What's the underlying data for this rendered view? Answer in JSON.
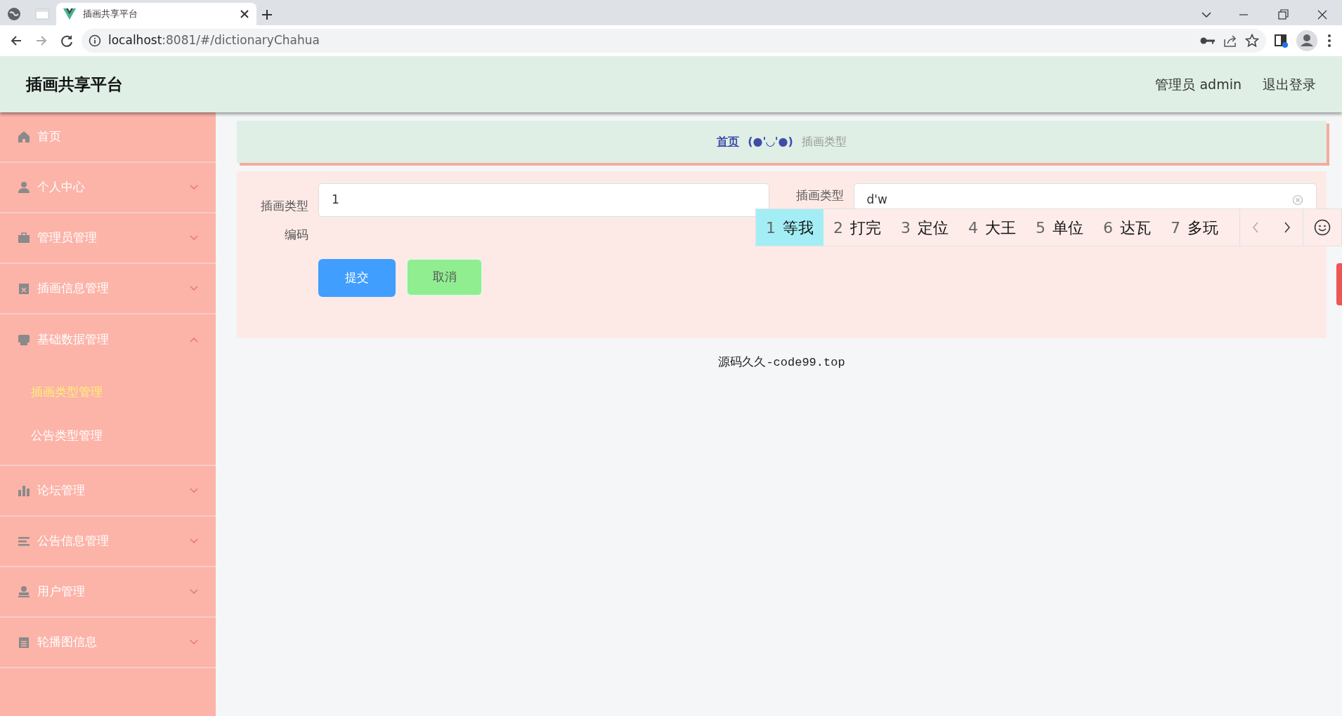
{
  "browser": {
    "tabs": [
      {
        "title": "插画共享平台",
        "selected": true
      }
    ],
    "url_host": "localhost",
    "url_rest": ":8081/#/dictionaryChahua"
  },
  "header": {
    "title": "插画共享平台",
    "user": "管理员 admin",
    "logout": "退出登录"
  },
  "sidebar": {
    "items": [
      {
        "label": "首页"
      },
      {
        "label": "个人中心",
        "expanded": false
      },
      {
        "label": "管理员管理",
        "expanded": false
      },
      {
        "label": "插画信息管理",
        "expanded": false
      },
      {
        "label": "基础数据管理",
        "expanded": true,
        "children": [
          {
            "label": "插画类型管理",
            "selected": true
          },
          {
            "label": "公告类型管理",
            "selected": false
          }
        ]
      },
      {
        "label": "论坛管理",
        "expanded": false
      },
      {
        "label": "公告信息管理",
        "expanded": false
      },
      {
        "label": "用户管理",
        "expanded": false
      },
      {
        "label": "轮播图信息",
        "expanded": false
      }
    ]
  },
  "breadcrumb": {
    "home": "首页",
    "separator": "(●'◡'●)",
    "current": "插画类型"
  },
  "form": {
    "fields": [
      {
        "label": "插画类型编码",
        "value": "1"
      },
      {
        "label": "插画类型",
        "value": "d'w"
      }
    ],
    "submit": "提交",
    "cancel": "取消"
  },
  "ime": {
    "candidates": [
      {
        "number": "1",
        "text": "等我",
        "selected": true
      },
      {
        "number": "2",
        "text": "打完",
        "selected": false
      },
      {
        "number": "3",
        "text": "定位",
        "selected": false
      },
      {
        "number": "4",
        "text": "大王",
        "selected": false
      },
      {
        "number": "5",
        "text": "单位",
        "selected": false
      },
      {
        "number": "6",
        "text": "达瓦",
        "selected": false
      },
      {
        "number": "7",
        "text": "多玩",
        "selected": false
      }
    ]
  },
  "footer": "源码久久-code99.top"
}
